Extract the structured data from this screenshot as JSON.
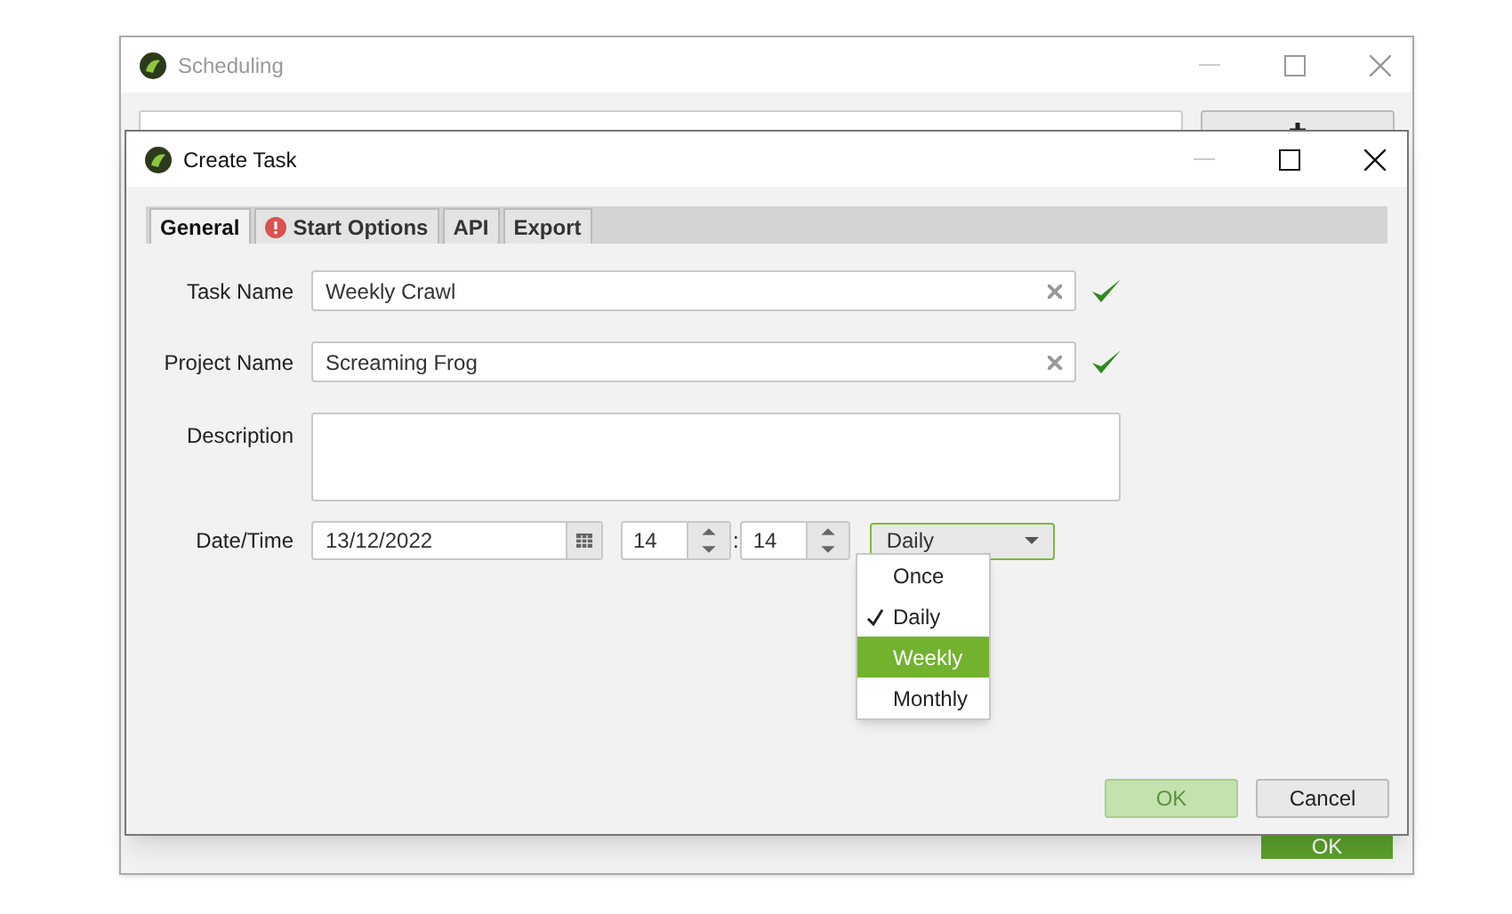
{
  "background_window": {
    "title": "Scheduling",
    "ok_button": "OK"
  },
  "dialog": {
    "title": "Create Task",
    "tabs": [
      {
        "label": "General",
        "selected": true,
        "error": false
      },
      {
        "label": "Start Options",
        "selected": false,
        "error": true
      },
      {
        "label": "API",
        "selected": false,
        "error": false
      },
      {
        "label": "Export",
        "selected": false,
        "error": false
      }
    ],
    "task_name": {
      "label": "Task Name",
      "value": "Weekly Crawl",
      "valid": true
    },
    "project_name": {
      "label": "Project Name",
      "value": "Screaming Frog",
      "valid": true
    },
    "description": {
      "label": "Description"
    },
    "datetime": {
      "label": "Date/Time",
      "date": "13/12/2022",
      "hour": "14",
      "separator": ":",
      "minute": "14",
      "frequency": "Daily",
      "dropdown_open": true
    },
    "frequency_options": [
      {
        "label": "Once",
        "checked": false,
        "highlighted": false
      },
      {
        "label": "Daily",
        "checked": true,
        "highlighted": false
      },
      {
        "label": "Weekly",
        "checked": false,
        "highlighted": true
      },
      {
        "label": "Monthly",
        "checked": false,
        "highlighted": false
      }
    ],
    "buttons": [
      {
        "label": "OK",
        "disabled": true
      },
      {
        "label": "Cancel",
        "disabled": false
      }
    ]
  }
}
